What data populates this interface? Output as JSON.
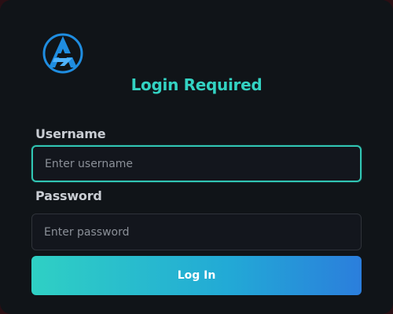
{
  "app": {
    "title": "Login Required",
    "logo_icon": "stylized-a-logo-icon"
  },
  "form": {
    "username": {
      "label": "Username",
      "placeholder": "Enter username",
      "value": ""
    },
    "password": {
      "label": "Password",
      "placeholder": "Enter password",
      "value": ""
    },
    "submit_label": "Log In"
  },
  "colors": {
    "accent": "#31c6b4",
    "title": "#33d2c2",
    "background": "#101418",
    "logo": "#1f8de0",
    "button_gradient_start": "#2fd0c4",
    "button_gradient_end": "#2b7edc"
  }
}
